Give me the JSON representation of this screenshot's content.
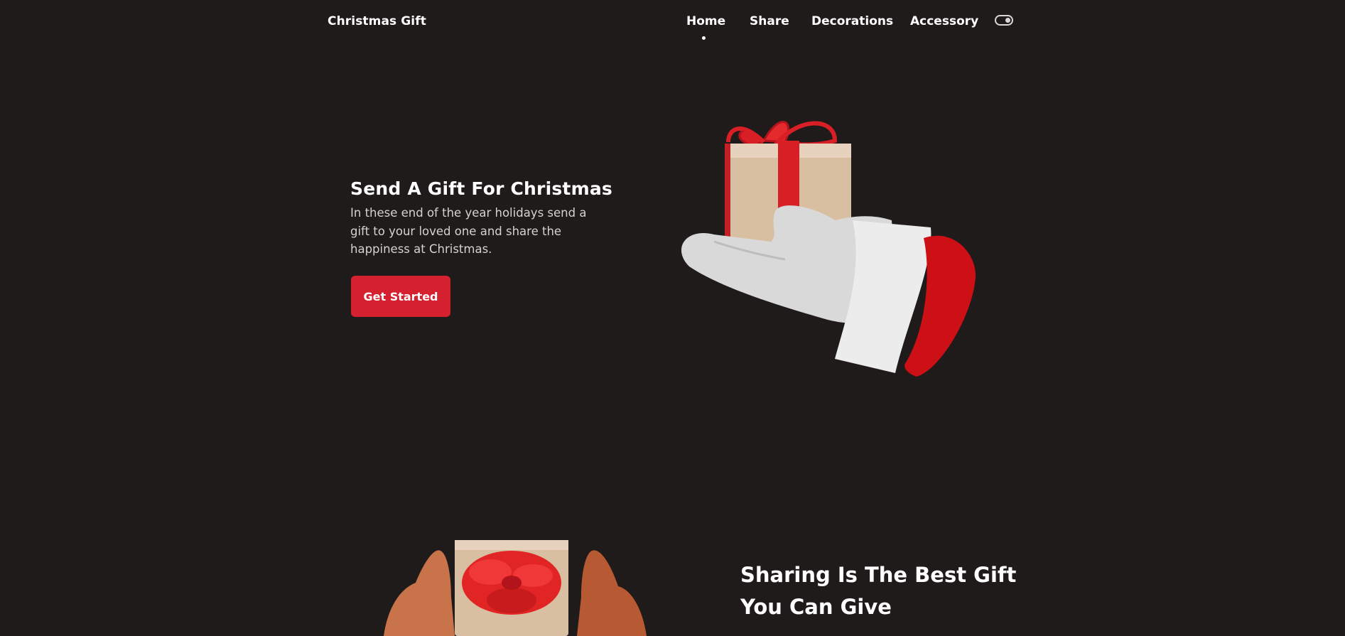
{
  "nav": {
    "logo": "Christmas Gift",
    "items": [
      {
        "label": "Home",
        "active": true
      },
      {
        "label": "Share"
      },
      {
        "label": "Decorations"
      },
      {
        "label": "Accessory"
      }
    ],
    "theme_toggle_icon": "toggle-icon"
  },
  "hero": {
    "title": "Send A Gift For Christmas",
    "description": "In these end of the year holidays send a gift to your loved one and share the happiness at Christmas.",
    "cta_label": "Get Started",
    "image_icon": "gift-hand-illustration"
  },
  "share": {
    "title": "Sharing Is The Best Gift You Can Give",
    "image_icon": "gift-box-hands-illustration"
  },
  "colors": {
    "background": "#201b1b",
    "accent": "#d4202f",
    "text": "#ffffff",
    "muted_text": "#d6d2d2"
  }
}
